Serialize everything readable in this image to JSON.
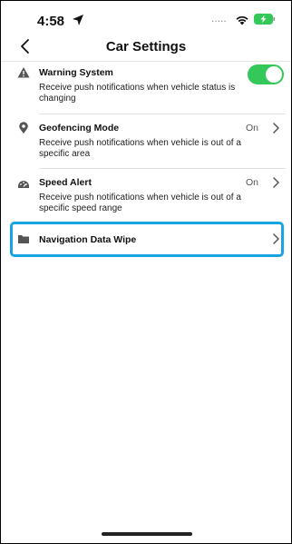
{
  "status_bar": {
    "time": "4:58",
    "signal_dots": "....."
  },
  "header": {
    "title": "Car Settings"
  },
  "settings": [
    {
      "title": "Warning System",
      "description": "Receive push notifications when vehicle status is changing",
      "toggle_on": true
    },
    {
      "title": "Geofencing Mode",
      "description": "Receive push notifications when vehicle is out of a specific area",
      "status": "On"
    },
    {
      "title": "Speed Alert",
      "description": "Receive push notifications when vehicle is out of a specific speed range",
      "status": "On"
    },
    {
      "title": "Navigation Data Wipe"
    }
  ],
  "icons": {
    "back": "chevron-left-icon",
    "warning": "warning-triangle-icon",
    "geofence": "location-pin-icon",
    "speed": "speedometer-icon",
    "navigation": "folder-icon",
    "chevron": "chevron-right-icon"
  },
  "colors": {
    "toggle_on": "#34c759",
    "highlight": "#18a4e0",
    "battery": "#34c759"
  }
}
